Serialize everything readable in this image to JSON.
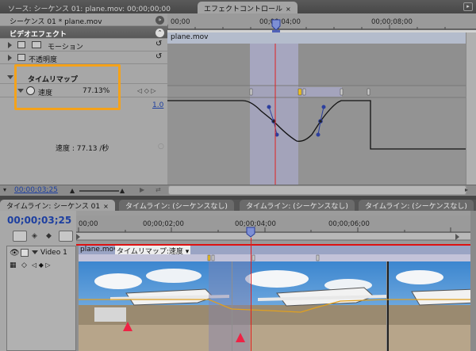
{
  "top_tabs": {
    "source_tab": "ソース: シーケンス 01: plane.mov: 00;00;00;00",
    "effect_tab": "エフェクトコントロール",
    "close": "×"
  },
  "effect_controls": {
    "sequence_label": "シーケンス 01 * plane.mov",
    "video_effects_label": "ビデオエフェクト",
    "clip_name": "plane.mov",
    "rows": {
      "motion": "モーション",
      "opacity": "不透明度",
      "time_remap": "タイムリマップ",
      "speed_label": "速度",
      "speed_value": "77.13%",
      "scale_value": "1.0",
      "speed_readout": "速度 : 77.13 /秒"
    },
    "ruler": {
      "t0": "00;00",
      "t1": "00;00;04;00",
      "t2": "00;00;08;00"
    },
    "bottom_timecode": "00;00;03;25"
  },
  "timeline": {
    "tabs": [
      "タイムライン: シーケンス 01",
      "タイムライン: (シーケンスなし)",
      "タイムライン: (シーケンスなし)",
      "タイムライン: (シーケンスなし)"
    ],
    "timecode": "00;00;03;25",
    "ruler": [
      "00;00",
      "00;00;02;00",
      "00;00;04;00",
      "00;00;06;00"
    ],
    "track_name": "Video 1",
    "clip_label": "plane.mov",
    "clip_effect_menu": "タイムリマップ:速度 ▾"
  },
  "colors": {
    "highlight": "#f4a21a",
    "playhead": "#e02020",
    "timecode": "#1d3fa0"
  }
}
